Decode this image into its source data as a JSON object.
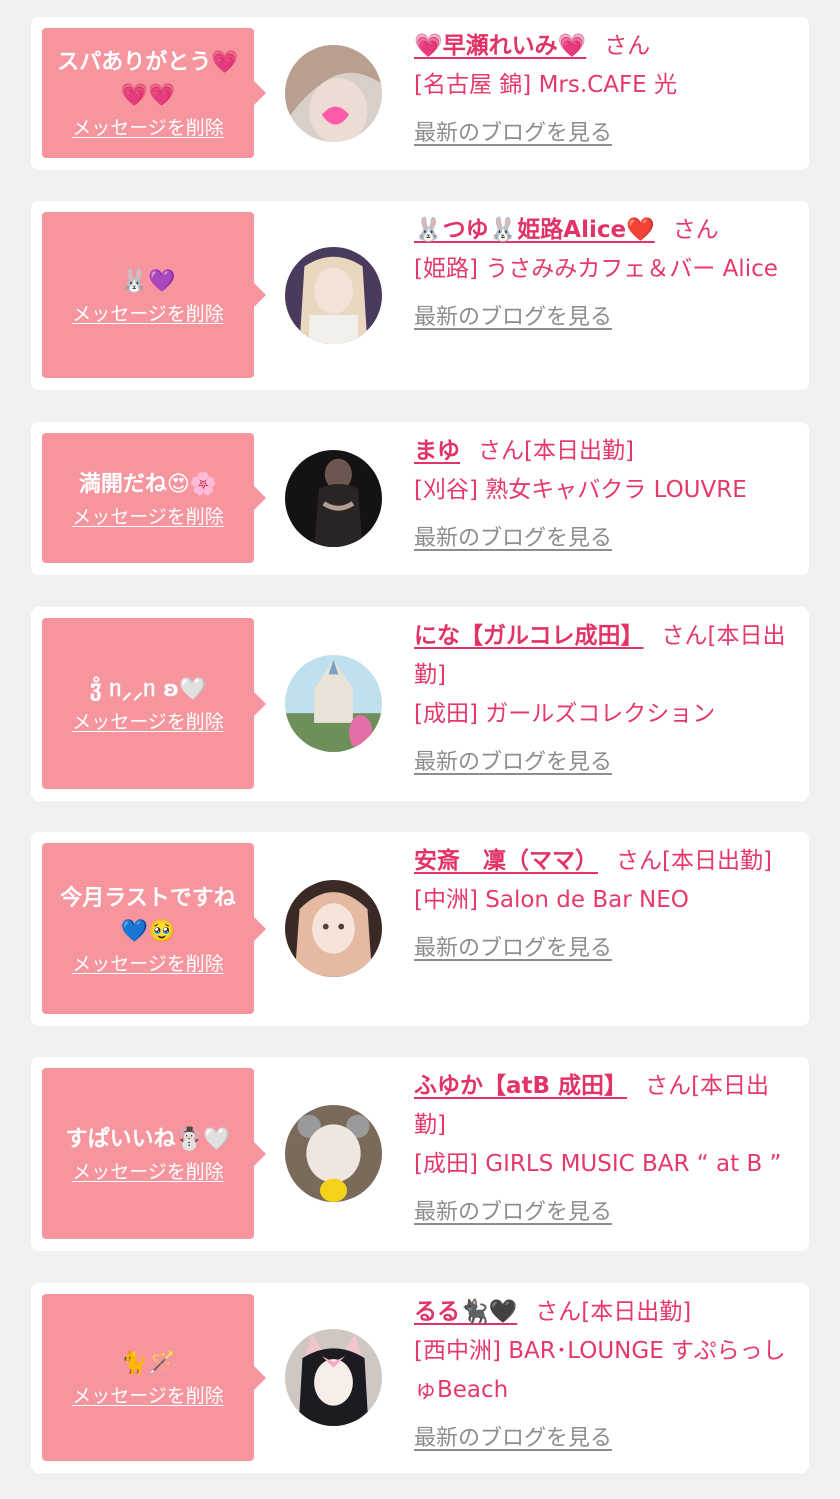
{
  "delete_label": "メッセージを削除",
  "san_label": "さん",
  "blog_label": "最新のブログを見る",
  "colors": {
    "bubble": "#f7959f",
    "accent": "#e23366",
    "muted": "#8d8d8d",
    "background": "#f1f1f1"
  },
  "items": [
    {
      "message": "スパありがとう💗💗💗",
      "name": "💗早瀬れいみ💗",
      "status": "",
      "shop": "[名古屋 錦] Mrs.CAFE 光"
    },
    {
      "message": "🐰💜",
      "name": "🐰つゆ🐰姫路Alice❤️",
      "status": "",
      "shop": "[姫路] うさみみカフェ＆バー Alice"
    },
    {
      "message": "満開だね😍🌸",
      "name": "まゆ",
      "status": "[本日出勤]",
      "shop": "[刈谷] 熟女キャバクラ LOUVRE"
    },
    {
      "message": "ჳ̊ ᥒ⸝⸝ᥒ ʚ🤍",
      "name": "にな【ガルコレ成田】",
      "status": "[本日出勤]",
      "shop": "[成田] ガールズコレクション"
    },
    {
      "message": "今月ラストですね💙🥹",
      "name": "安斎　凜（ママ）",
      "status": "[本日出勤]",
      "shop": "[中洲] Salon de Bar NEO"
    },
    {
      "message": "すぱいいね☃️🤍",
      "name": "ふゆか【atB 成田】",
      "status": "[本日出勤]",
      "shop": "[成田] GIRLS MUSIC BAR “ at B ”"
    },
    {
      "message": "🐈🪄",
      "name": "るる🐈‍⬛🖤",
      "status": "[本日出勤]",
      "shop": "[西中洲] BAR･LOUNGE すぷらっしゅBeach"
    }
  ]
}
